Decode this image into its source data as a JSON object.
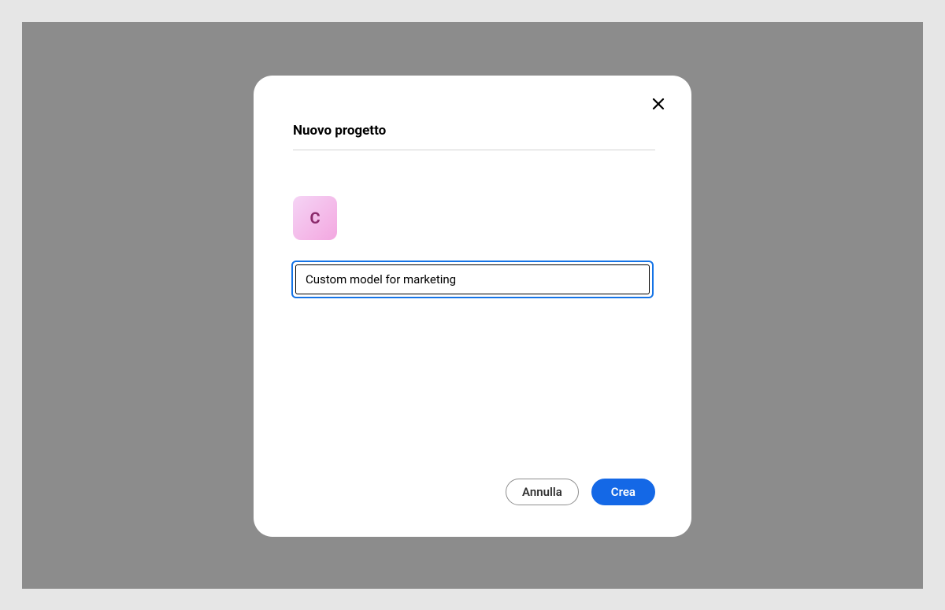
{
  "modal": {
    "title": "Nuovo progetto",
    "project_icon_letter": "C",
    "project_name_value": "Custom model for marketing",
    "cancel_label": "Annulla",
    "create_label": "Crea"
  }
}
